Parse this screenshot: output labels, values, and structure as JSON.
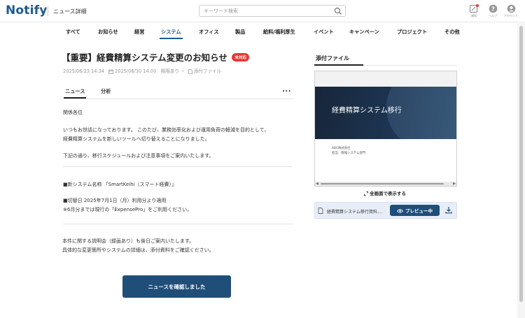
{
  "header": {
    "logo": "Notify",
    "page_label": "ニュース詳細",
    "search_placeholder": "キーワード検索",
    "icons": [
      {
        "name": "notification-icon",
        "label": "通知"
      },
      {
        "name": "help-icon",
        "label": "ヘルプ"
      },
      {
        "name": "account-icon",
        "label": "アカウント"
      }
    ]
  },
  "categories": [
    "すべて",
    "お知らせ",
    "経営",
    "システム",
    "オフィス",
    "製品",
    "給料/福利厚生",
    "イベント",
    "キャンペーン",
    "プロジェクト",
    "その他"
  ],
  "active_category": "システム",
  "article": {
    "title": "【重要】経費精算システム変更のお知らせ",
    "badge": "未対応",
    "date_posted": "2025/06/23 14:34",
    "date_deadline": "2025/06/30 14:00",
    "deadline_label": "期限あり",
    "attachment_label": "添付ファイル",
    "tabs": [
      "ニュース",
      "分析"
    ],
    "more": "...",
    "body": {
      "greeting": "関係各位",
      "intro1": "いつもお世話になっております。 このたび、業務効率化および運用負荷の軽減を目的として、",
      "intro2": "経費精算システムを新しいツールへ切り替えることになりました。",
      "schedule": "下記の通り、移行スケジュールおよび注意事項をご案内いたします。",
      "system_name": "■新システム名称 「SmartKeihi（スマート経費）」",
      "switch_date": "■切替日 2025年7月1日（月）利用分より適用",
      "note": "※6月分までは現行の「ExpensePro」をご利用ください。",
      "closing1": "本件に関する説明会（録画あり）も後日ご案内いたします。",
      "closing2": "具体的な変更箇所やシステムの詳細は、添付資料をご確認ください。"
    },
    "confirm_button": "ニュースを確認しました"
  },
  "attachments": {
    "title": "添付ファイル",
    "slide_title": "経費精算システム移行",
    "slide_company": "ABC株式会社",
    "slide_dept": "担当：情報システム部門",
    "fullscreen_label": "全画面で表示する",
    "file_name": "経費精算システム移行資料....",
    "preview_button": "プレビュー中"
  }
}
